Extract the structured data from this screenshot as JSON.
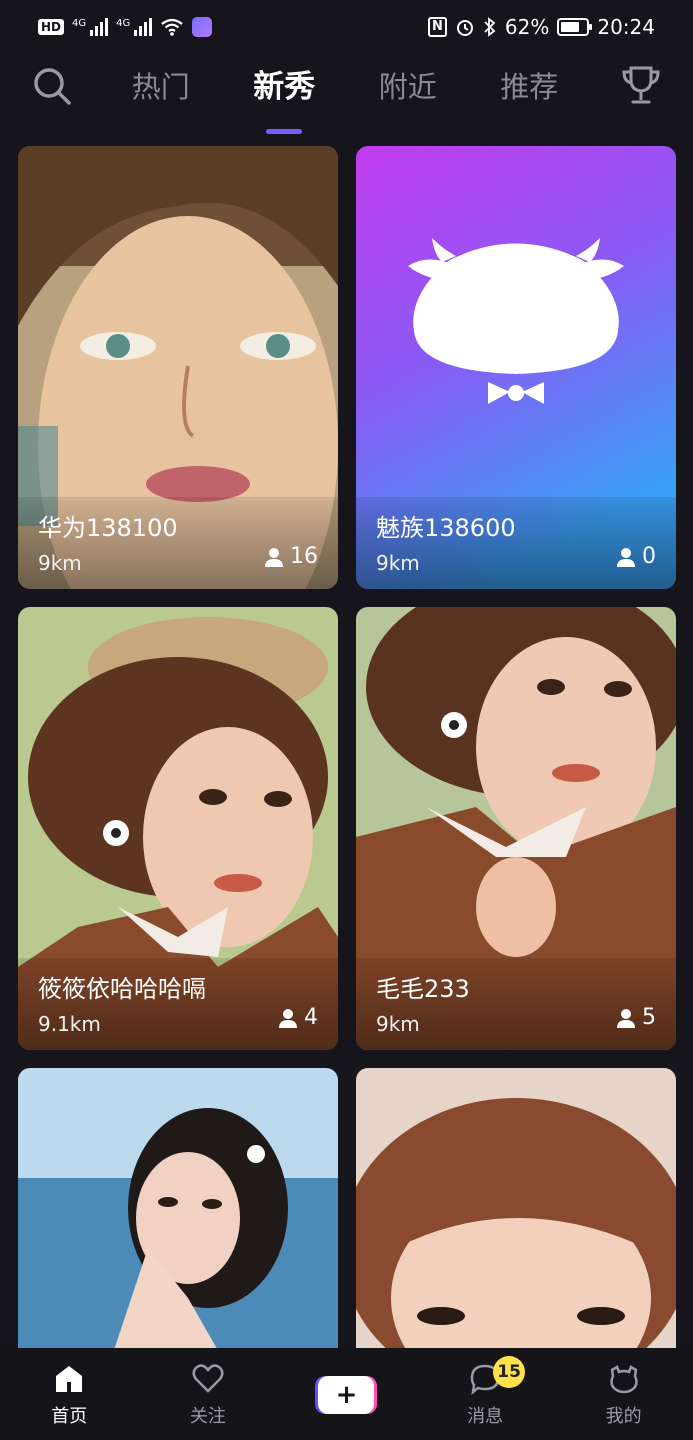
{
  "status_bar": {
    "hd": "HD",
    "net1": "4G",
    "net2": "4G",
    "battery_text": "62%",
    "time": "20:24",
    "battery_level": 0.62,
    "nfc_glyph": "N"
  },
  "tabs": [
    {
      "label": "热门",
      "active": false
    },
    {
      "label": "新秀",
      "active": true
    },
    {
      "label": "附近",
      "active": false
    },
    {
      "label": "推荐",
      "active": false
    }
  ],
  "cards": [
    {
      "name": "华为138100",
      "distance": "9km",
      "count": "16"
    },
    {
      "name": "魅族138600",
      "distance": "9km",
      "count": "0"
    },
    {
      "name": "筱筱依哈哈哈嗝",
      "distance": "9.1km",
      "count": "4"
    },
    {
      "name": "毛毛233",
      "distance": "9km",
      "count": "5"
    },
    {
      "name": "",
      "distance": "",
      "count": ""
    },
    {
      "name": "",
      "distance": "",
      "count": ""
    }
  ],
  "bottom_nav": {
    "home": "首页",
    "follow": "关注",
    "add": "+",
    "messages": "消息",
    "messages_badge": "15",
    "mine": "我的"
  },
  "colors": {
    "background": "#15151b",
    "accent": "#7b5cff",
    "badge": "#ffe14a"
  },
  "icons": [
    "search-icon",
    "trophy-icon",
    "person-icon",
    "home-icon",
    "heart-icon",
    "chat-bubble-icon",
    "cat-face-icon",
    "bull-mascot-icon"
  ]
}
